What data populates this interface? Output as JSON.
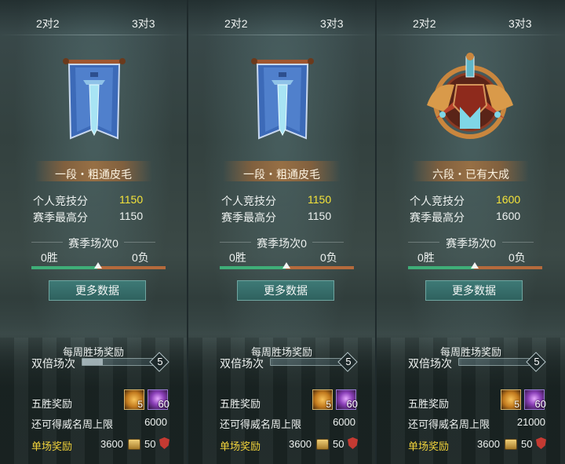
{
  "panels": [
    {
      "tab_2v2": "2对2",
      "tab_3v3": "3对3",
      "emblem": "banner-sword-icon",
      "rank_name": "一段・粗通皮毛",
      "personal_label": "个人竞技分",
      "personal_value": "1150",
      "season_high_label": "赛季最高分",
      "season_high_value": "1150",
      "season_matches": "赛季场次0",
      "wins": "0胜",
      "losses": "0负",
      "more_data": "更多数据",
      "weekly_title": "每周胜场奖励",
      "double_label": "双倍场次",
      "double_count": "5",
      "five_win_label": "五胜奖励",
      "five_win_chest_count": "5",
      "five_win_gem_count": "60",
      "remaining_label": "还可得威名周上限",
      "remaining_value": "6000",
      "single_label": "单场奖励",
      "single_coins": "3600",
      "single_shield": "50"
    },
    {
      "tab_2v2": "2对2",
      "tab_3v3": "3对3",
      "emblem": "banner-sword-icon",
      "rank_name": "一段・粗通皮毛",
      "personal_label": "个人竞技分",
      "personal_value": "1150",
      "season_high_label": "赛季最高分",
      "season_high_value": "1150",
      "season_matches": "赛季场次0",
      "wins": "0胜",
      "losses": "0负",
      "more_data": "更多数据",
      "weekly_title": "每周胜场奖励",
      "double_label": "双倍场次",
      "double_count": "5",
      "five_win_label": "五胜奖励",
      "five_win_chest_count": "5",
      "five_win_gem_count": "60",
      "remaining_label": "还可得威名周上限",
      "remaining_value": "6000",
      "single_label": "单场奖励",
      "single_coins": "3600",
      "single_shield": "50"
    },
    {
      "tab_2v2": "2对2",
      "tab_3v3": "3对3",
      "emblem": "ornate-helmet-crest-icon",
      "rank_name": "六段・已有大成",
      "personal_label": "个人竞技分",
      "personal_value": "1600",
      "season_high_label": "赛季最高分",
      "season_high_value": "1600",
      "season_matches": "赛季场次0",
      "wins": "0胜",
      "losses": "0负",
      "more_data": "更多数据",
      "weekly_title": "每周胜场奖励",
      "double_label": "双倍场次",
      "double_count": "5",
      "five_win_label": "五胜奖励",
      "five_win_chest_count": "5",
      "five_win_gem_count": "60",
      "remaining_label": "还可得威名周上限",
      "remaining_value": "21000",
      "single_label": "单场奖励",
      "single_coins": "3600",
      "single_shield": "50"
    }
  ],
  "colors": {
    "score_yellow": "#f5e43a",
    "win_green": "#3fae78",
    "loss_orange": "#b56a3c",
    "single_reward_gold": "#f2d43c"
  }
}
